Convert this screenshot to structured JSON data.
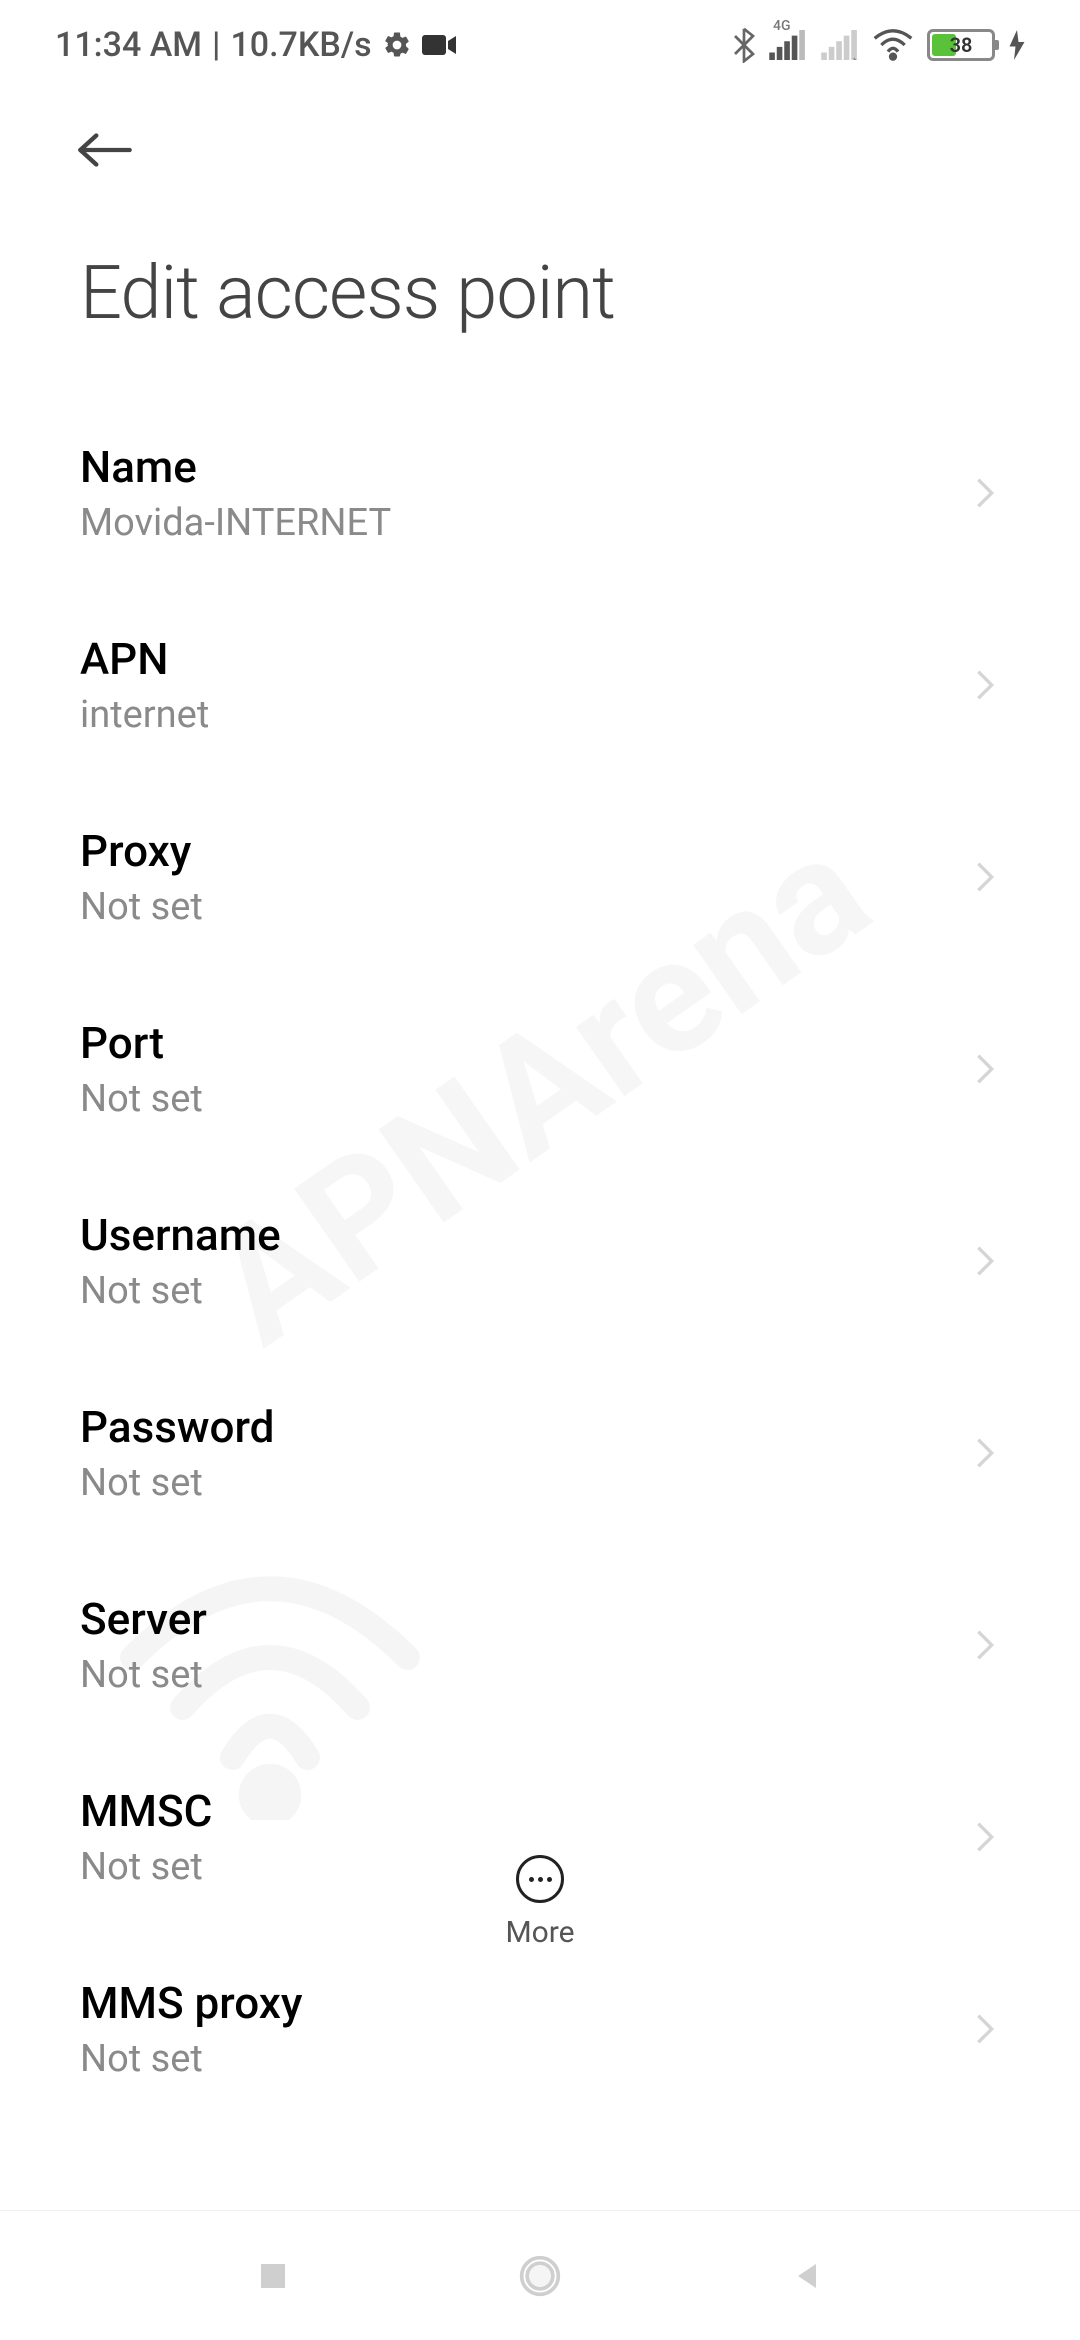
{
  "status": {
    "time": "11:34 AM",
    "data_rate": "10.7KB/s",
    "battery_percent": "38",
    "network_type": "4G"
  },
  "page": {
    "title": "Edit access point"
  },
  "settings": [
    {
      "label": "Name",
      "value": "Movida-INTERNET"
    },
    {
      "label": "APN",
      "value": "internet"
    },
    {
      "label": "Proxy",
      "value": "Not set"
    },
    {
      "label": "Port",
      "value": "Not set"
    },
    {
      "label": "Username",
      "value": "Not set"
    },
    {
      "label": "Password",
      "value": "Not set"
    },
    {
      "label": "Server",
      "value": "Not set"
    },
    {
      "label": "MMSC",
      "value": "Not set"
    },
    {
      "label": "MMS proxy",
      "value": "Not set"
    }
  ],
  "actions": {
    "more_label": "More"
  },
  "watermark": {
    "text": "APNArena"
  }
}
